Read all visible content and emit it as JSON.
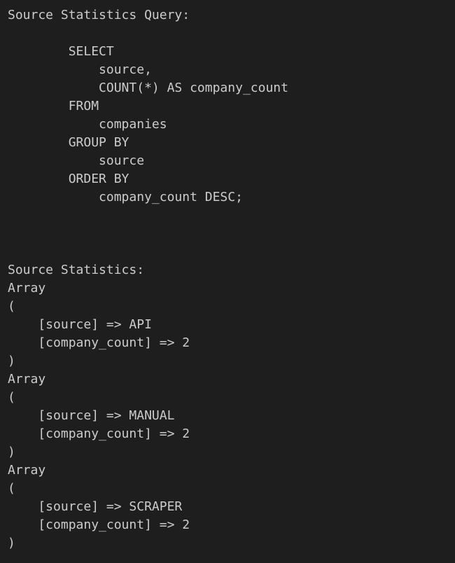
{
  "output": {
    "lines": [
      "Source Statistics Query:",
      "",
      "        SELECT",
      "            source,",
      "            COUNT(*) AS company_count",
      "        FROM",
      "            companies",
      "        GROUP BY",
      "            source",
      "        ORDER BY",
      "            company_count DESC;",
      "",
      "",
      "",
      "Source Statistics:",
      "Array",
      "(",
      "    [source] => API",
      "    [company_count] => 2",
      ")",
      "Array",
      "(",
      "    [source] => MANUAL",
      "    [company_count] => 2",
      ")",
      "Array",
      "(",
      "    [source] => SCRAPER",
      "    [company_count] => 2",
      ")"
    ]
  },
  "colors": {
    "background": "#1e1e1e",
    "foreground": "#cccccc"
  }
}
